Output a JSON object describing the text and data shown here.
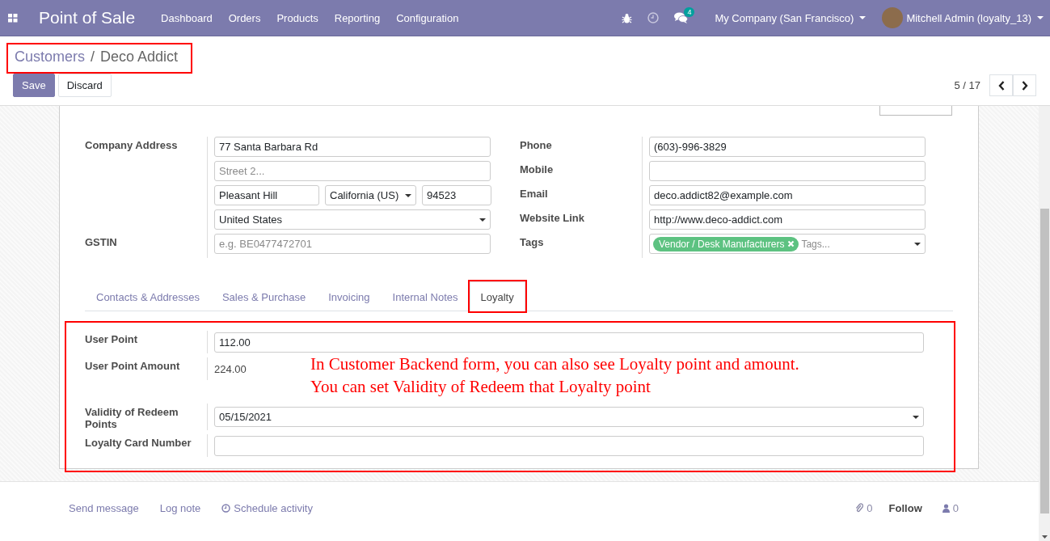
{
  "app": {
    "title": "Point of Sale",
    "menu": [
      "Dashboard",
      "Orders",
      "Products",
      "Reporting",
      "Configuration"
    ],
    "messages_count": "4",
    "company": "My Company (San Francisco)",
    "user": "Mitchell Admin (loyalty_13)"
  },
  "breadcrumb": {
    "parent": "Customers",
    "separator": "/",
    "current": "Deco Addict",
    "highlighted": true
  },
  "buttons": [
    {
      "label": "Save",
      "kind": "primary"
    },
    {
      "label": "Discard",
      "kind": "secondary"
    }
  ],
  "pager": "5 / 17",
  "address": {
    "label": "Company Address",
    "street": "77 Santa Barbara Rd",
    "street2_placeholder": "Street 2...",
    "city": "Pleasant Hill",
    "state": "California (US)",
    "zip": "94523",
    "country": "United States"
  },
  "gstin": {
    "label": "GSTIN",
    "placeholder": "e.g. BE0477472701"
  },
  "contact_fields": [
    {
      "label": "Phone",
      "value": "(603)-996-3829"
    },
    {
      "label": "Mobile"
    },
    {
      "label": "Email",
      "value": "deco.addict82@example.com"
    },
    {
      "label": "Website Link",
      "value": "http://www.deco-addict.com"
    }
  ],
  "tags": {
    "label": "Tags",
    "items": [
      "Vendor / Desk Manufacturers"
    ],
    "placeholder": "Tags..."
  },
  "tabs": [
    {
      "label": "Contacts & Addresses",
      "selected": false,
      "highlighted": false
    },
    {
      "label": "Sales & Purchase",
      "selected": false,
      "highlighted": false
    },
    {
      "label": "Invoicing",
      "selected": false,
      "highlighted": false
    },
    {
      "label": "Internal Notes",
      "selected": false,
      "highlighted": false
    },
    {
      "label": "Loyalty",
      "selected": true,
      "highlighted": true
    }
  ],
  "loyalty": {
    "highlighted": true,
    "fields": [
      {
        "label": "User Point",
        "kind": "input",
        "value": "112.00"
      },
      {
        "label": "User Point Amount",
        "kind": "text",
        "value": "224.00"
      },
      {
        "label": "Validity of Redeem Points",
        "kind": "select",
        "value": "05/15/2021"
      },
      {
        "label": "Loyalty Card Number",
        "kind": "input"
      }
    ]
  },
  "annotations": [
    "In Customer Backend form, you can also see Loyalty point and amount.",
    "You can set Validity of Redeem that Loyalty point"
  ],
  "chatter": {
    "actions": [
      {
        "label": "Send message",
        "kind": "link"
      },
      {
        "label": "Log note",
        "kind": "link"
      },
      {
        "label": "Schedule activity",
        "kind": "activity"
      }
    ],
    "attachments": "0",
    "follow": "Follow",
    "followers": "0"
  }
}
